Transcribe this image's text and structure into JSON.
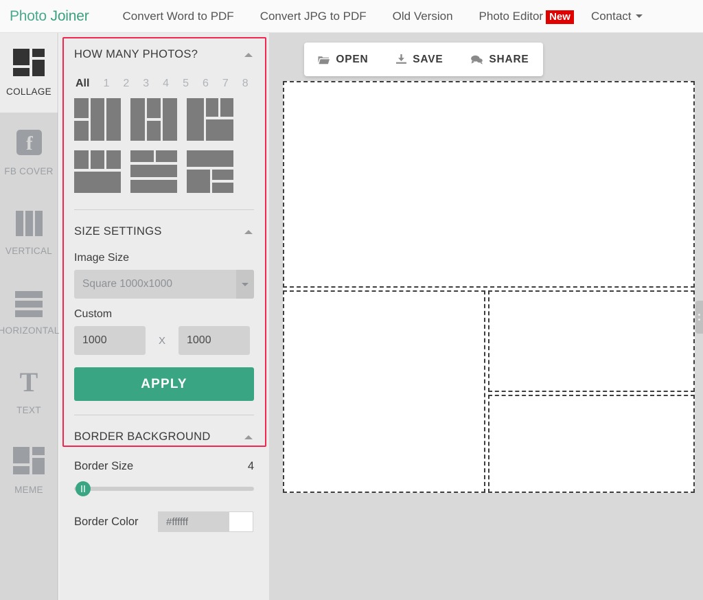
{
  "nav": {
    "brand_first": "Photo ",
    "brand_second": "Joiner",
    "links": [
      {
        "label": "Convert Word to PDF"
      },
      {
        "label": "Convert JPG to PDF"
      },
      {
        "label": "Old Version"
      },
      {
        "label": "Photo Editor",
        "badge": "New"
      },
      {
        "label": "Contact",
        "caret": true
      }
    ]
  },
  "rail": {
    "items": [
      {
        "label": "COLLAGE",
        "icon": "collage-icon",
        "active": true
      },
      {
        "label": "FB COVER",
        "icon": "facebook-icon",
        "active": false
      },
      {
        "label": "VERTICAL",
        "icon": "vertical-bars-icon",
        "active": false
      },
      {
        "label": "HORIZONTAL",
        "icon": "horizontal-bars-icon",
        "active": false
      },
      {
        "label": "TEXT",
        "icon": "text-t-icon",
        "active": false
      },
      {
        "label": "MEME",
        "icon": "meme-icon",
        "active": false
      }
    ]
  },
  "panels": {
    "how_many": {
      "title": "HOW MANY PHOTOS?",
      "collapse_icon": "chevron-up-icon",
      "counts": [
        "All",
        "1",
        "2",
        "3",
        "4",
        "5",
        "6",
        "7",
        "8"
      ],
      "selected_count": "All",
      "layouts": [
        {
          "name": "layout-1"
        },
        {
          "name": "layout-2"
        },
        {
          "name": "layout-3"
        },
        {
          "name": "layout-4"
        },
        {
          "name": "layout-5"
        },
        {
          "name": "layout-6"
        }
      ]
    },
    "size_settings": {
      "title": "SIZE SETTINGS",
      "collapse_icon": "chevron-up-icon",
      "image_size_label": "Image Size",
      "image_size_value": "Square 1000x1000",
      "custom_label": "Custom",
      "custom_width": "1000",
      "custom_height": "1000",
      "x_separator": "X",
      "apply_label": "APPLY"
    },
    "border_background": {
      "title": "BORDER BACKGROUND",
      "collapse_icon": "chevron-up-icon",
      "border_size_label": "Border Size",
      "border_size_value": "4",
      "border_color_label": "Border Color",
      "border_color_value": "#ffffff"
    }
  },
  "toolbar": {
    "open_label": "OPEN",
    "save_label": "SAVE",
    "share_label": "SHARE"
  },
  "canvas": {
    "cells": [
      {
        "name": "collage-cell-1"
      },
      {
        "name": "collage-cell-2"
      },
      {
        "name": "collage-cell-3"
      },
      {
        "name": "collage-cell-4"
      }
    ]
  },
  "colors": {
    "brand": "#3aa583",
    "accent_red": "#f2264f",
    "badge_red": "#e00000",
    "panel_bg": "#ececec",
    "rail_bg": "#d6d6d6",
    "stage_bg": "#d9d9d9"
  }
}
